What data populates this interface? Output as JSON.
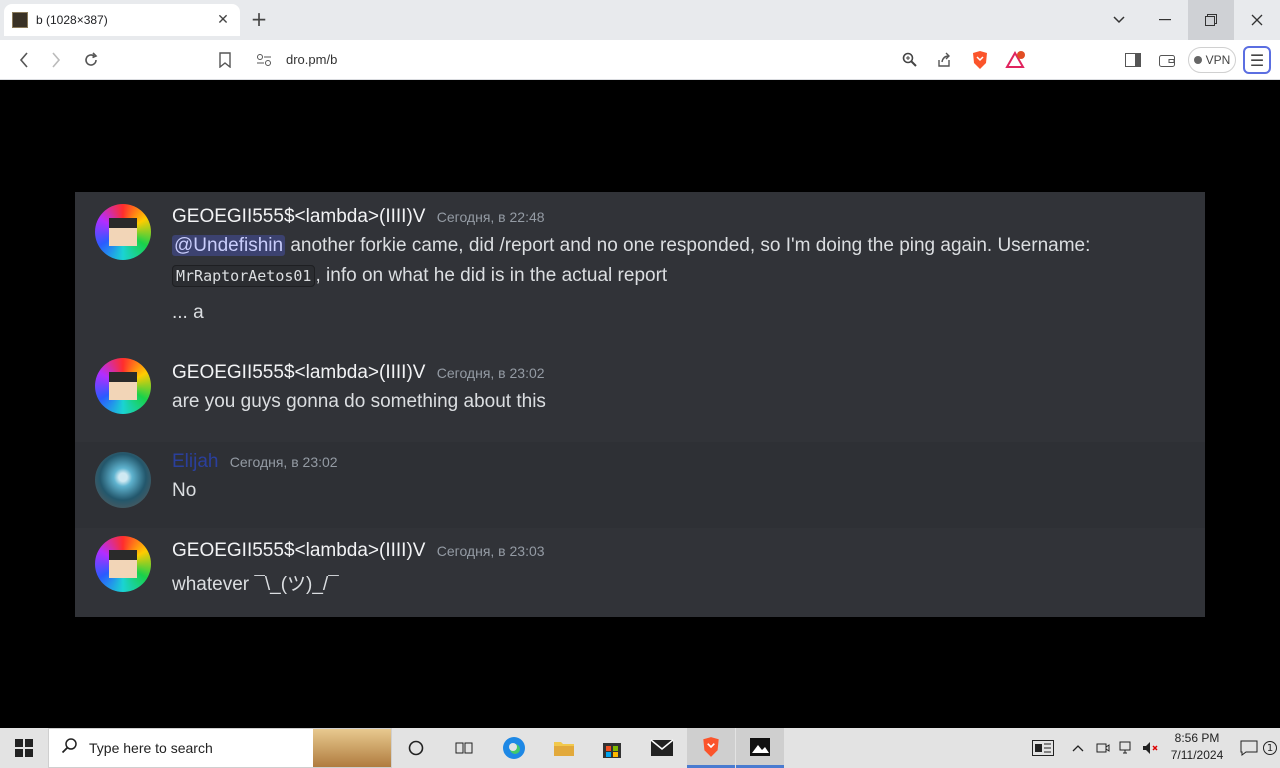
{
  "browser": {
    "tab_title": "b (1028×387)",
    "url": "dro.pm/b",
    "vpn_label": "VPN",
    "notification_count": "1"
  },
  "messages": [
    {
      "username": "GEOEGII555$<lambda>(IIII)V",
      "timestamp": "Сегодня, в 22:48",
      "mention": "@Undefishin",
      "line1_text": " another forkie came, did /report and no one responded, so I'm doing the ping again. Username:",
      "code": "MrRaptorAetos01",
      "line2_text": ", info on what he did is in the actual report",
      "line3_text": "... a"
    },
    {
      "username": "GEOEGII555$<lambda>(IIII)V",
      "timestamp": "Сегодня, в 23:02",
      "text": "are you guys gonna do something about this"
    },
    {
      "username": "Elijah",
      "timestamp": "Сегодня, в 23:02",
      "text": "No"
    },
    {
      "username": "GEOEGII555$<lambda>(IIII)V",
      "timestamp": "Сегодня, в 23:03",
      "text": "whatever ¯\\_(ツ)_/¯"
    }
  ],
  "taskbar": {
    "search_placeholder": "Type here to search",
    "time": "8:56 PM",
    "date": "7/11/2024",
    "notification_badge": "1"
  },
  "colors": {
    "panel_bg": "#313338",
    "mention_bg": "#3c4270",
    "elijah_name": "#2a3f9c"
  }
}
